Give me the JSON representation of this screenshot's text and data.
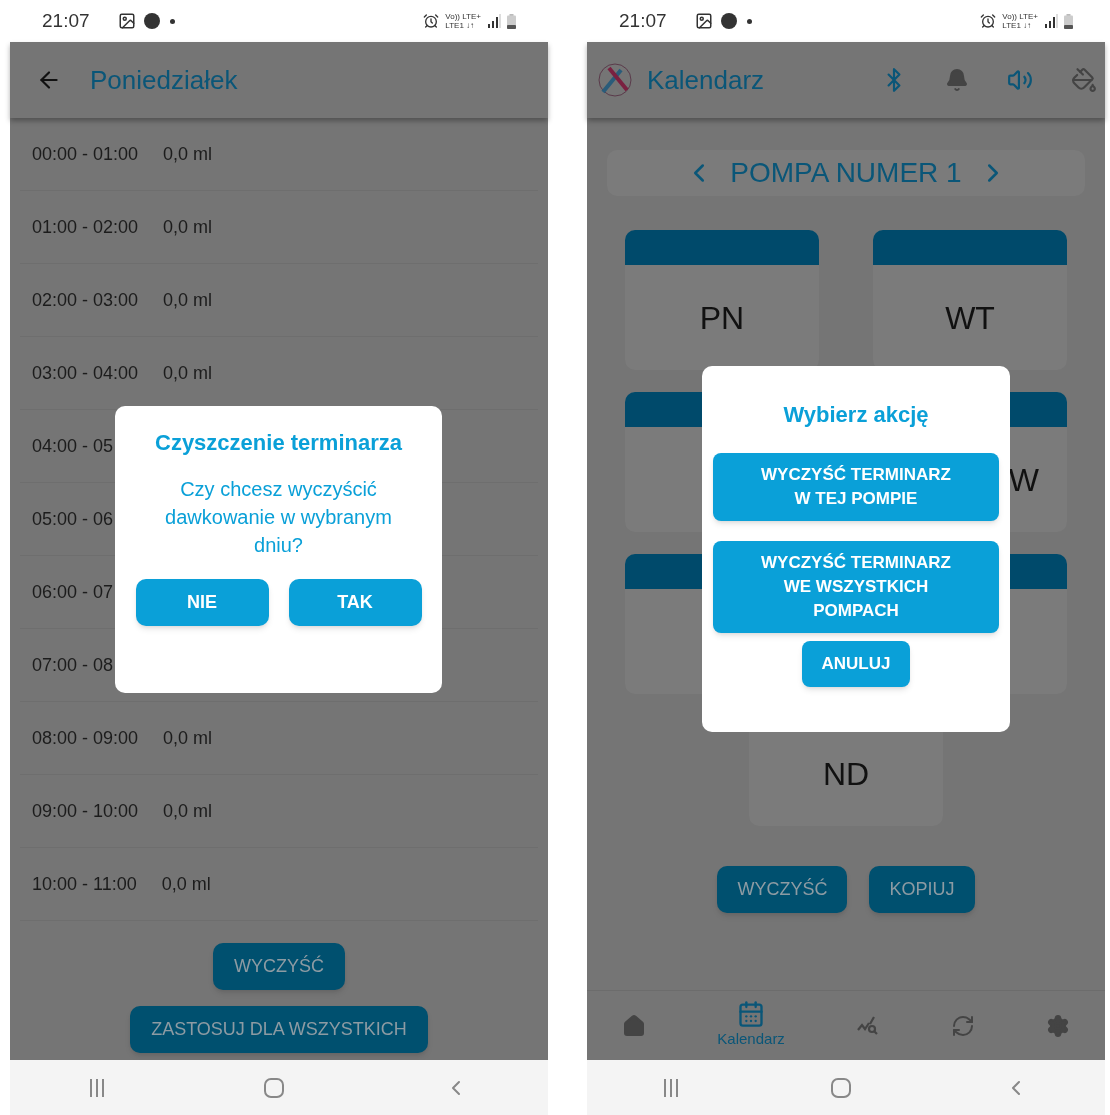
{
  "left_screen": {
    "status_bar": {
      "time": "21:07",
      "network_top": "Vo)) LTE+",
      "network_bottom": "LTE1 ↓↑"
    },
    "app_bar": {
      "title": "Poniedziałek"
    },
    "rows": [
      {
        "time": "00:00 - 01:00",
        "amount": "0,0 ml"
      },
      {
        "time": "01:00 - 02:00",
        "amount": "0,0 ml"
      },
      {
        "time": "02:00 - 03:00",
        "amount": "0,0 ml"
      },
      {
        "time": "03:00 - 04:00",
        "amount": "0,0 ml"
      },
      {
        "time": "04:00 - 05"
      },
      {
        "time": "05:00 - 06"
      },
      {
        "time": "06:00 - 07"
      },
      {
        "time": "07:00 - 08"
      },
      {
        "time": "08:00 - 09:00",
        "amount": "0,0 ml"
      },
      {
        "time": "09:00 - 10:00",
        "amount": "0,0 ml"
      },
      {
        "time": "10:00 - 11:00",
        "amount": "0,0 ml"
      }
    ],
    "buttons": [
      "WYCZYŚĆ",
      "ZASTOSUJ DLA WSZYSTKICH"
    ],
    "dialog": {
      "title": "Czyszczenie terminarza",
      "message": "Czy chcesz wyczyścić dawkowanie w wybranym dniu?",
      "buttons": [
        "NIE",
        "TAK"
      ]
    }
  },
  "right_screen": {
    "status_bar": {
      "time": "21:07",
      "network_top": "Vo)) LTE+",
      "network_bottom": "LTE1 ↓↑"
    },
    "app_bar": {
      "title": "Kalendarz"
    },
    "pump_selector": {
      "label": "POMPA NUMER 1"
    },
    "days": [
      {
        "kind": "labeled",
        "label": "PN"
      },
      {
        "kind": "labeled",
        "label": "WT"
      },
      {
        "kind": "covered"
      },
      {
        "kind": "partly_covered",
        "label": "W"
      },
      {
        "kind": "covered"
      },
      {
        "kind": "covered"
      },
      {
        "kind": "labeled",
        "label": "ND"
      }
    ],
    "buttons": [
      "WYCZYŚĆ",
      "KOPIUJ"
    ],
    "bottom_nav": [
      {
        "kind": "home",
        "selected": false
      },
      {
        "kind": "calendar",
        "label": "Kalendarz",
        "selected": true
      },
      {
        "kind": "chart",
        "selected": false
      },
      {
        "kind": "sync",
        "selected": false
      },
      {
        "kind": "settings",
        "selected": false
      }
    ],
    "dialog": {
      "title": "Wybierz akcję",
      "actions": [
        "WYCZYŚĆ TERMINARZ\nW TEJ POMPIE",
        "WYCZYŚĆ TERMINARZ\nWE WSZYSTKICH\nPOMPACH"
      ],
      "cancel": "ANULUJ"
    }
  }
}
